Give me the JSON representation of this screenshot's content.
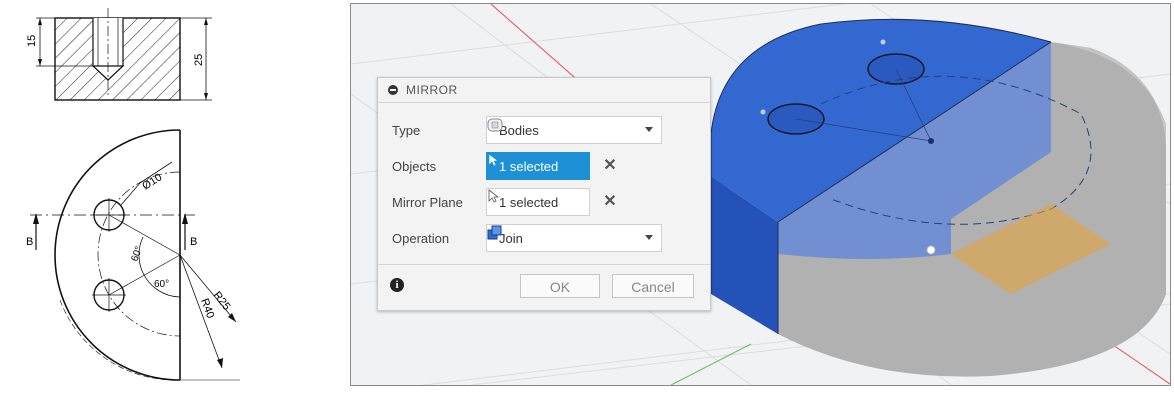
{
  "drawing": {
    "dim_15": "15",
    "dim_25": "25",
    "dim_dia": "Ø10",
    "angle_a": "60°",
    "angle_b": "60°",
    "radius_inner": "R25",
    "radius_outer": "R40",
    "section_left": "B",
    "section_right": "B"
  },
  "dialog": {
    "title": "MIRROR",
    "rows": [
      {
        "label": "Type",
        "value": "Bodies",
        "icon": "body-icon"
      },
      {
        "label": "Objects",
        "value": "1 selected",
        "icon": "cursor-icon",
        "selected": true
      },
      {
        "label": "Mirror Plane",
        "value": "1 selected",
        "icon": "cursor-icon"
      },
      {
        "label": "Operation",
        "value": "Join",
        "icon": "join-icon"
      }
    ],
    "ok": "OK",
    "cancel": "Cancel"
  },
  "colors": {
    "body_blue": "#2d63c8",
    "body_gray": "#a8a8a8",
    "accent": "#1e90d6",
    "plane_orange": "#e3a13d"
  }
}
